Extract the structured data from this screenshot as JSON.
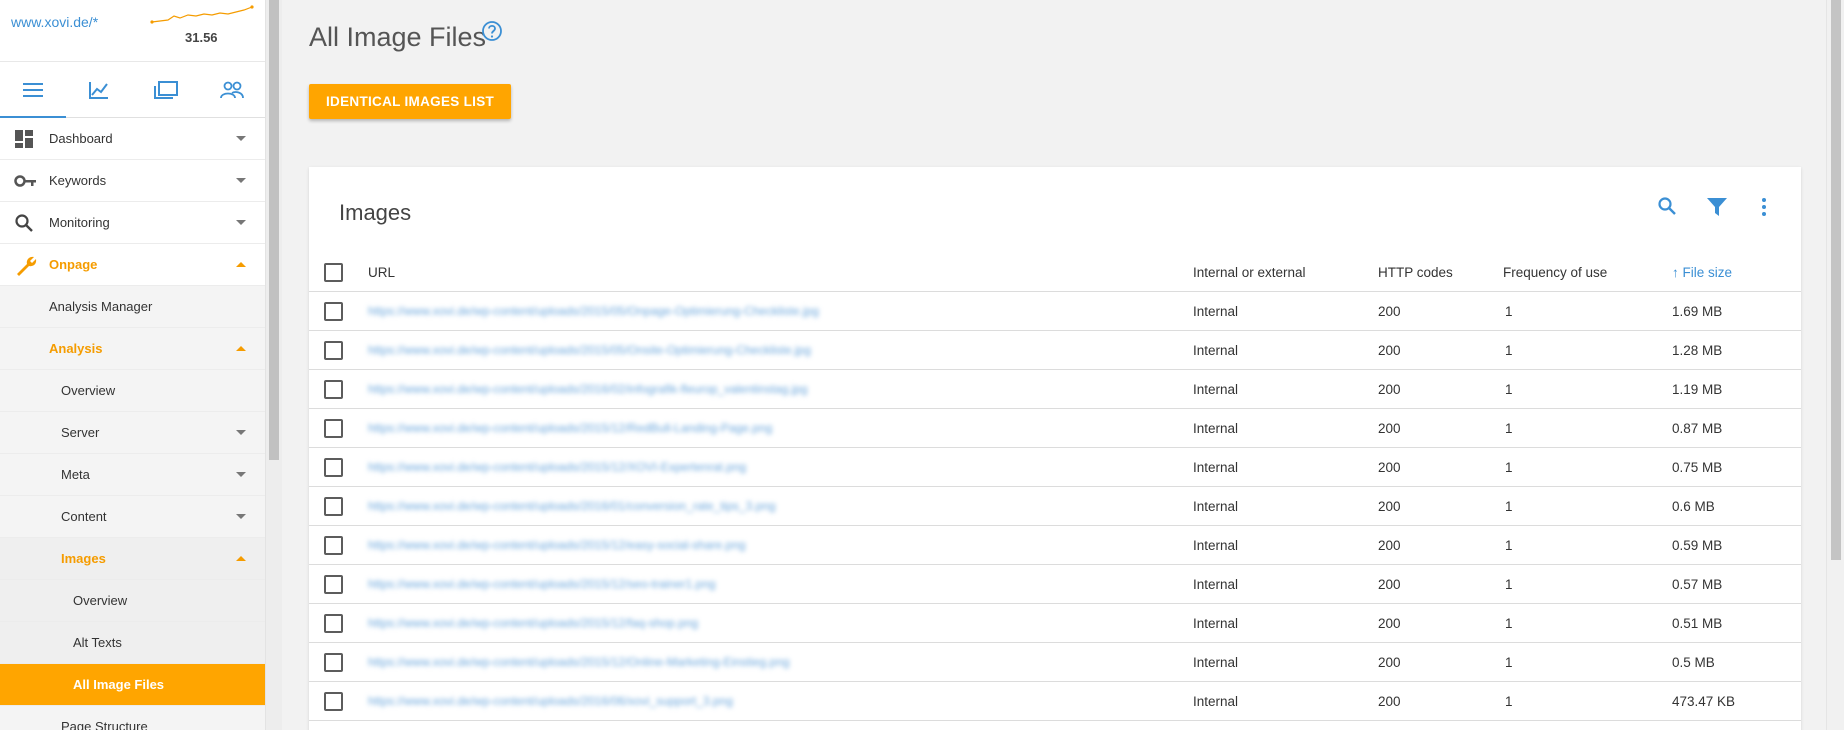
{
  "sidebar": {
    "domain": "www.xovi.de/*",
    "sparkline_value": "31.56",
    "tabs": [
      {
        "icon": "menu-icon"
      },
      {
        "icon": "chart-line-icon"
      },
      {
        "icon": "folders-icon"
      },
      {
        "icon": "users-icon"
      }
    ],
    "menu": {
      "dashboard": "Dashboard",
      "keywords": "Keywords",
      "monitoring": "Monitoring",
      "onpage": "Onpage",
      "analysis_manager": "Analysis Manager",
      "analysis": "Analysis",
      "overview": "Overview",
      "server": "Server",
      "meta": "Meta",
      "content": "Content",
      "images": "Images",
      "images_overview": "Overview",
      "alt_texts": "Alt Texts",
      "all_image_files": "All Image Files",
      "page_structure": "Page Structure"
    }
  },
  "page": {
    "title": "All Image Files",
    "identical_button": "IDENTICAL IMAGES LIST"
  },
  "card": {
    "title": "Images",
    "columns": {
      "url": "URL",
      "internal": "Internal or external",
      "http": "HTTP codes",
      "frequency": "Frequency of use",
      "filesize": "File size",
      "sort_arrow": "↑"
    },
    "rows": [
      {
        "url": "https://www.xovi.de/wp-content/uploads/2015/05/Onpage-Optimierung-Checkliste.jpg",
        "type": "Internal",
        "http": "200",
        "freq": "1",
        "size": "1.69 MB"
      },
      {
        "url": "https://www.xovi.de/wp-content/uploads/2015/05/Onsite-Optimierung-Checkliste.jpg",
        "type": "Internal",
        "http": "200",
        "freq": "1",
        "size": "1.28 MB"
      },
      {
        "url": "https://www.xovi.de/wp-content/uploads/2016/02/infografik-fleurop_valentinstag.jpg",
        "type": "Internal",
        "http": "200",
        "freq": "1",
        "size": "1.19 MB"
      },
      {
        "url": "https://www.xovi.de/wp-content/uploads/2015/12/RedBull-Landing-Page.png",
        "type": "Internal",
        "http": "200",
        "freq": "1",
        "size": "0.87 MB"
      },
      {
        "url": "https://www.xovi.de/wp-content/uploads/2015/12/XOVI-Expertenrat.png",
        "type": "Internal",
        "http": "200",
        "freq": "1",
        "size": "0.75 MB"
      },
      {
        "url": "https://www.xovi.de/wp-content/uploads/2016/01/conversion_rate_tips_3.png",
        "type": "Internal",
        "http": "200",
        "freq": "1",
        "size": "0.6 MB"
      },
      {
        "url": "https://www.xovi.de/wp-content/uploads/2015/12/easy-social-share.png",
        "type": "Internal",
        "http": "200",
        "freq": "1",
        "size": "0.59 MB"
      },
      {
        "url": "https://www.xovi.de/wp-content/uploads/2015/12/seo-trainer1.png",
        "type": "Internal",
        "http": "200",
        "freq": "1",
        "size": "0.57 MB"
      },
      {
        "url": "https://www.xovi.de/wp-content/uploads/2015/12/faq-shop.png",
        "type": "Internal",
        "http": "200",
        "freq": "1",
        "size": "0.51 MB"
      },
      {
        "url": "https://www.xovi.de/wp-content/uploads/2015/12/Online-Marketing-Einstieg.png",
        "type": "Internal",
        "http": "200",
        "freq": "1",
        "size": "0.5 MB"
      },
      {
        "url": "https://www.xovi.de/wp-content/uploads/2016/06/xovi_support_3.png",
        "type": "Internal",
        "http": "200",
        "freq": "1",
        "size": "473.47 KB"
      }
    ]
  },
  "colors": {
    "accent": "#ffa500",
    "link": "#3b8fd4"
  }
}
